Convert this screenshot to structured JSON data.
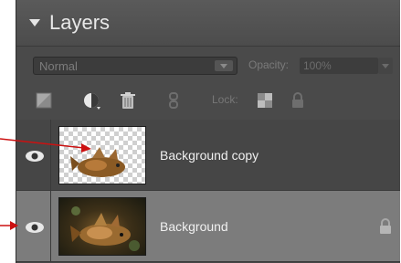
{
  "panel": {
    "title": "Layers"
  },
  "options": {
    "blend_mode": "Normal",
    "opacity_label": "Opacity:",
    "opacity_value": "100%"
  },
  "toolbar": {
    "icons": [
      "new-layer-icon",
      "adjustment-layer-icon",
      "trash-icon",
      "link-icon",
      "lock-transparency-icon",
      "lock-all-icon"
    ],
    "lock_label": "Lock:"
  },
  "layers": [
    {
      "name": "Background copy",
      "visible": true,
      "selected": false,
      "locked": false,
      "thumbnail": "checkerboard-with-object"
    },
    {
      "name": "Background",
      "visible": true,
      "selected": true,
      "locked": true,
      "thumbnail": "photo"
    }
  ],
  "annotation": {
    "arrow_color": "#cc1111"
  }
}
